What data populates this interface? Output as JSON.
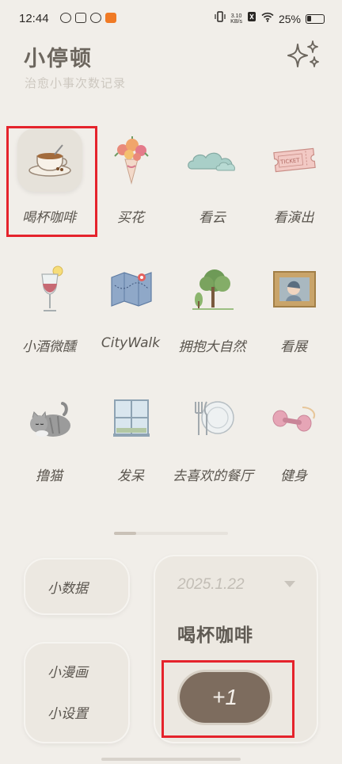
{
  "status": {
    "time": "12:44",
    "speed_value": "3.10",
    "speed_unit": "KB/s",
    "battery": "25%"
  },
  "header": {
    "title": "小停顿",
    "subtitle": "治愈小事次数记录",
    "sparkle_icon": "sparkle-icon"
  },
  "activities": [
    {
      "label": "喝杯咖啡",
      "icon": "coffee-cup-icon",
      "selected": true
    },
    {
      "label": "买花",
      "icon": "flower-bouquet-icon"
    },
    {
      "label": "看云",
      "icon": "cloud-icon"
    },
    {
      "label": "看演出",
      "icon": "ticket-icon"
    },
    {
      "label": "小酒微醺",
      "icon": "wine-glass-icon"
    },
    {
      "label": "CityWalk",
      "icon": "map-icon"
    },
    {
      "label": "拥抱大自然",
      "icon": "trees-icon"
    },
    {
      "label": "看展",
      "icon": "framed-painting-icon"
    },
    {
      "label": "撸猫",
      "icon": "cat-icon"
    },
    {
      "label": "发呆",
      "icon": "window-icon"
    },
    {
      "label": "去喜欢的餐厅",
      "icon": "plate-cutlery-icon"
    },
    {
      "label": "健身",
      "icon": "dumbbell-icon"
    }
  ],
  "bottom": {
    "data_label": "小数据",
    "comic_label": "小漫画",
    "settings_label": "小设置",
    "counter": {
      "date": "2025.1.22",
      "activity": "喝杯咖啡",
      "plus_label": "+1"
    }
  },
  "colors": {
    "background": "#f1eee9",
    "card": "#ece8e1",
    "plus_button": "#7d6c5e",
    "highlight": "#e5232c"
  }
}
